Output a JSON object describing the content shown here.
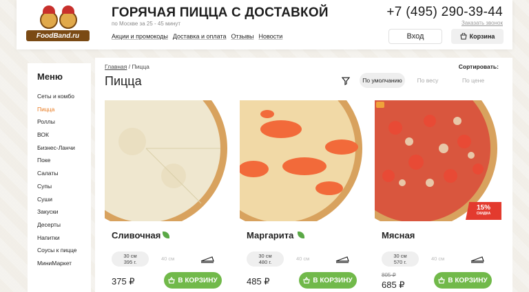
{
  "header": {
    "logo_text": "FoodBand.ru",
    "title": "ГОРЯЧАЯ ПИЦЦА С ДОСТАВКОЙ",
    "subtitle": "по Москве за 25 - 45 минут",
    "nav": [
      "Акции и промокоды",
      "Доставка и оплата",
      "Отзывы",
      "Новости"
    ],
    "phone": "+7 (495) 290-39-44",
    "callback": "Заказать звонок",
    "login": "Вход",
    "cart": "Корзина"
  },
  "sidebar": {
    "title": "Меню",
    "items": [
      "Сеты и комбо",
      "Пицца",
      "Роллы",
      "ВОК",
      "Бизнес-Ланчи",
      "Поке",
      "Салаты",
      "Супы",
      "Суши",
      "Закуски",
      "Десерты",
      "Напитки",
      "Соусы к пицце",
      "МиниМаркет"
    ],
    "active_item": "Пицца"
  },
  "breadcrumb": {
    "home": "Главная",
    "separator": "/",
    "current": "Пицца"
  },
  "page_title": "Пицца",
  "sort": {
    "label": "Сортировать:",
    "options": [
      "По умолчанию",
      "По весу",
      "По цене"
    ],
    "active": "По умолчанию"
  },
  "products": [
    {
      "name": "Сливочная",
      "size": "30 см",
      "weight": "395 г.",
      "alt_size": "40 см",
      "price": "375 ₽",
      "button": "В КОРЗИНУ",
      "vegetarian": true
    },
    {
      "name": "Маргарита",
      "size": "30 см",
      "weight": "480 г.",
      "alt_size": "40 см",
      "price": "485 ₽",
      "button": "В КОРЗИНУ",
      "vegetarian": true
    },
    {
      "name": "Мясная",
      "size": "30 см",
      "weight": "570 г.",
      "alt_size": "40 см",
      "old_price": "805 ₽",
      "price": "685 ₽",
      "button": "В КОРЗИНУ",
      "discount": "15%",
      "discount_label": "СКИДКА"
    }
  ],
  "colors": {
    "accent": "#e8791e",
    "buy": "#71b94a",
    "discount": "#e33a2e"
  }
}
